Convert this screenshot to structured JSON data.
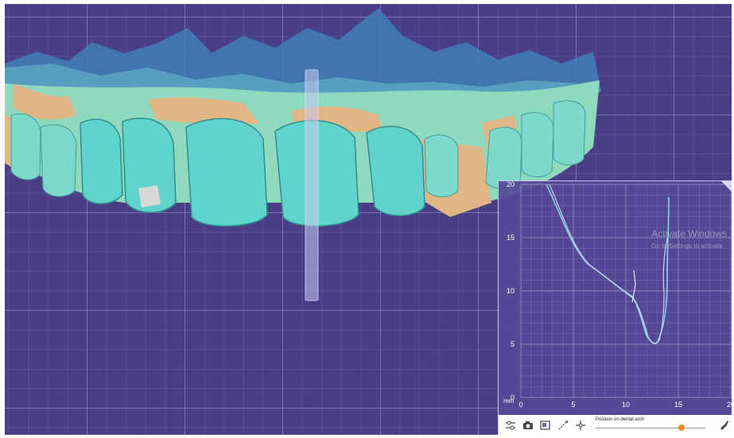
{
  "scene": {
    "background_color": "#4a3f86",
    "model_colors": {
      "tooth": "#5fd3cc",
      "gingiva_scan": "#8fd9bf",
      "gingiva_wax": "#e0b784",
      "scan_shadow": "#3a8fb0"
    },
    "icons": [
      "section-plane-icon"
    ]
  },
  "profile_panel": {
    "unit": "mm",
    "x_ticks": [
      "0",
      "5",
      "10",
      "15",
      "20"
    ],
    "y_ticks": [
      "0",
      "5",
      "10",
      "15",
      "20"
    ],
    "series_colors": [
      "#7fd6e6",
      "#c8d2f0"
    ]
  },
  "toolbar": {
    "icons": [
      "sliders-icon",
      "camera-icon",
      "screen-capture-icon",
      "measure-icon",
      "crosshair-icon",
      "brush-icon"
    ],
    "slider_label": "Position on dental arch",
    "slider_position": 0.78
  },
  "watermark": {
    "title": "Activate Windows",
    "subtitle": "Go to Settings to activate"
  }
}
